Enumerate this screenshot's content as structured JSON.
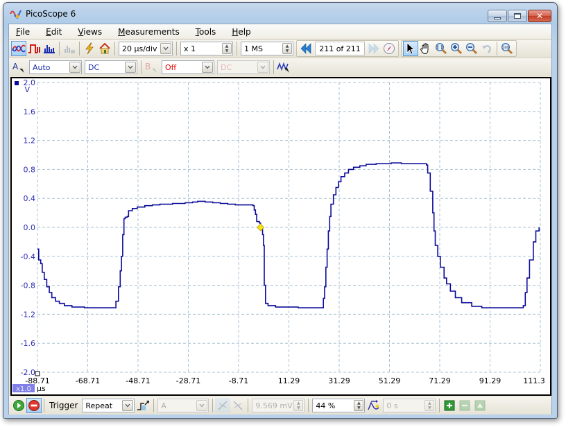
{
  "window": {
    "title": "PicoScope 6",
    "controls": {
      "minimize": "minimize",
      "maximize": "maximize",
      "close": "close"
    }
  },
  "menu": [
    {
      "label": "File",
      "accel": "F"
    },
    {
      "label": "Edit",
      "accel": "E"
    },
    {
      "label": "Views",
      "accel": "V"
    },
    {
      "label": "Measurements",
      "accel": "M"
    },
    {
      "label": "Tools",
      "accel": "T"
    },
    {
      "label": "Help",
      "accel": "H"
    }
  ],
  "toolbar": {
    "modes": [
      {
        "name": "scope-mode",
        "icon": "sine-wave-icon",
        "active": true
      },
      {
        "name": "persistence-mode",
        "icon": "pulse-icon",
        "active": false
      },
      {
        "name": "spectrum-mode",
        "icon": "spectrum-bars-icon",
        "active": false
      },
      {
        "name": "math-channels",
        "icon": "math-bars-icon",
        "disabled": true
      }
    ],
    "auto_setup_icon": "lightning-icon",
    "default_setup_icon": "home-icon",
    "timebase": "20 µs/div",
    "zoom_factor": "x 1",
    "samples": "1 MS",
    "buffer": {
      "label": "211  of 211",
      "current": 211,
      "total": 211
    },
    "tools": [
      {
        "name": "select-tool",
        "icon": "arrow-cursor-icon",
        "active": true
      },
      {
        "name": "hand-tool",
        "icon": "hand-icon"
      },
      {
        "name": "zoom-area-tool",
        "icon": "zoom-area-icon"
      },
      {
        "name": "zoom-in-tool",
        "icon": "zoom-in-icon"
      },
      {
        "name": "zoom-out-tool",
        "icon": "zoom-out-icon"
      },
      {
        "name": "undo-zoom-tool",
        "icon": "undo-icon",
        "disabled": true
      },
      {
        "name": "zoom-100-tool",
        "icon": "zoom-100-icon"
      }
    ]
  },
  "channels": {
    "a": {
      "label": "A",
      "range": "Auto",
      "coupling": "DC"
    },
    "b": {
      "label": "B",
      "range": "Off",
      "coupling": "DC",
      "disabled": true
    }
  },
  "colors": {
    "trace": "#0b0b9a",
    "grid": "#a9c3d6",
    "axis_text_y": "#2b2bb5",
    "trigger_marker": "#f5e21a",
    "range_off": "#e00000",
    "scale_badge": "#8080e8"
  },
  "scope": {
    "y_unit": "V",
    "x_unit": "µs",
    "x_scale_badge": "x1.0"
  },
  "chart_data": {
    "type": "line",
    "title": "",
    "xlabel": "µs",
    "ylabel": "V",
    "xlim": [
      -88.71,
      111.29
    ],
    "ylim": [
      -2.0,
      2.0
    ],
    "grid": true,
    "x_ticks": [
      "-88.71",
      "-68.71",
      "-48.71",
      "-28.71",
      "-8.71",
      "11.29",
      "31.29",
      "51.29",
      "71.29",
      "91.29",
      "111.3"
    ],
    "y_ticks": [
      "2.0",
      "1.6",
      "1.2",
      "0.8",
      "0.4",
      "0.0",
      "-0.4",
      "-0.8",
      "-1.2",
      "-1.6",
      "-2.0"
    ],
    "trigger": {
      "x": 0.0,
      "y": 0.0
    },
    "series": [
      {
        "name": "Channel A",
        "points": [
          [
            -88.7,
            -0.3
          ],
          [
            -88.2,
            -0.45
          ],
          [
            -87.4,
            -0.5
          ],
          [
            -86.8,
            -0.62
          ],
          [
            -86.0,
            -0.72
          ],
          [
            -85.0,
            -0.82
          ],
          [
            -84.0,
            -0.9
          ],
          [
            -83.0,
            -0.97
          ],
          [
            -81.5,
            -1.02
          ],
          [
            -80.0,
            -1.05
          ],
          [
            -78.0,
            -1.08
          ],
          [
            -75.0,
            -1.1
          ],
          [
            -70.0,
            -1.11
          ],
          [
            -62.0,
            -1.11
          ],
          [
            -58.0,
            -1.11
          ],
          [
            -57.5,
            -1.02
          ],
          [
            -56.5,
            -0.82
          ],
          [
            -55.8,
            -0.6
          ],
          [
            -55.3,
            -0.4
          ],
          [
            -54.8,
            -0.1
          ],
          [
            -54.3,
            0.12
          ],
          [
            -53.8,
            0.14
          ],
          [
            -53.0,
            0.15
          ],
          [
            -52.5,
            0.23
          ],
          [
            -51.0,
            0.26
          ],
          [
            -49.0,
            0.28
          ],
          [
            -46.0,
            0.3
          ],
          [
            -43.0,
            0.31
          ],
          [
            -40.0,
            0.32
          ],
          [
            -35.0,
            0.33
          ],
          [
            -30.0,
            0.34
          ],
          [
            -27.0,
            0.35
          ],
          [
            -25.0,
            0.36
          ],
          [
            -22.0,
            0.35
          ],
          [
            -19.0,
            0.34
          ],
          [
            -16.0,
            0.33
          ],
          [
            -13.0,
            0.32
          ],
          [
            -10.0,
            0.31
          ],
          [
            -7.0,
            0.31
          ],
          [
            -3.0,
            0.3
          ],
          [
            -2.5,
            0.24
          ],
          [
            -2.0,
            0.18
          ],
          [
            -1.5,
            0.08
          ],
          [
            -0.5,
            0.06
          ],
          [
            0.0,
            0.0
          ],
          [
            0.8,
            -0.1
          ],
          [
            1.2,
            -0.25
          ],
          [
            1.5,
            -0.8
          ],
          [
            2.0,
            -1.05
          ],
          [
            3.0,
            -1.08
          ],
          [
            6.0,
            -1.1
          ],
          [
            15.0,
            -1.11
          ],
          [
            24.0,
            -1.11
          ],
          [
            25.0,
            -0.98
          ],
          [
            25.5,
            -0.82
          ],
          [
            26.0,
            -0.55
          ],
          [
            26.5,
            -0.3
          ],
          [
            27.0,
            -0.05
          ],
          [
            27.5,
            0.15
          ],
          [
            28.0,
            0.32
          ],
          [
            29.0,
            0.45
          ],
          [
            30.0,
            0.55
          ],
          [
            31.0,
            0.63
          ],
          [
            32.0,
            0.7
          ],
          [
            33.5,
            0.75
          ],
          [
            35.0,
            0.8
          ],
          [
            37.0,
            0.83
          ],
          [
            39.5,
            0.85
          ],
          [
            42.0,
            0.87
          ],
          [
            46.0,
            0.88
          ],
          [
            52.0,
            0.89
          ],
          [
            56.0,
            0.88
          ],
          [
            64.0,
            0.88
          ],
          [
            66.0,
            0.86
          ],
          [
            66.5,
            0.75
          ],
          [
            67.5,
            0.5
          ],
          [
            68.5,
            0.2
          ],
          [
            69.0,
            -0.05
          ],
          [
            69.5,
            -0.25
          ],
          [
            70.5,
            -0.4
          ],
          [
            71.5,
            -0.55
          ],
          [
            73.0,
            -0.7
          ],
          [
            74.0,
            -0.78
          ],
          [
            75.5,
            -0.88
          ],
          [
            77.5,
            -0.97
          ],
          [
            80.0,
            -1.04
          ],
          [
            84.0,
            -1.09
          ],
          [
            88.0,
            -1.11
          ],
          [
            96.0,
            -1.11
          ],
          [
            104.0,
            -1.11
          ],
          [
            104.5,
            -1.08
          ],
          [
            105.3,
            -0.9
          ],
          [
            106.0,
            -0.7
          ],
          [
            107.0,
            -0.45
          ],
          [
            108.5,
            -0.2
          ],
          [
            109.5,
            -0.05
          ],
          [
            110.8,
            0.0
          ]
        ]
      }
    ]
  },
  "status": {
    "run_icon": "start-icon",
    "stop_icon": "stop-icon",
    "trigger_label": "Trigger",
    "trigger_mode": "Repeat",
    "trigger_source": "A",
    "threshold": "9.569 mV",
    "pre_trigger": "44 %",
    "post_trigger_delay": "0 s",
    "add_measurement_icon": "add-measurement-icon",
    "delete_measurement_icon": "delete-measurement-icon",
    "edit_measurement_icon": "edit-measurement-icon"
  }
}
